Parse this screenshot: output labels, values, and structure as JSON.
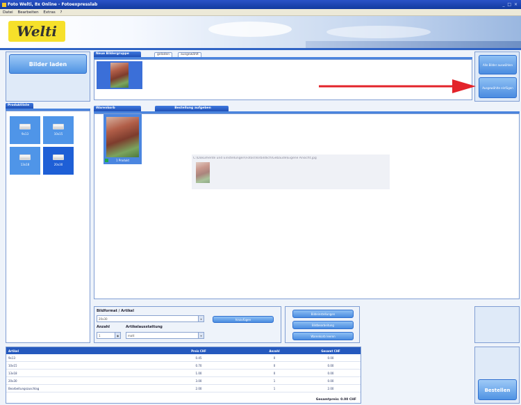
{
  "window": {
    "title": "Foto Welti, 8x Online - Fotoexpresslab",
    "controls": "_ □ ×"
  },
  "menu": [
    {
      "label": "Datei"
    },
    {
      "label": "Bearbeiten"
    },
    {
      "label": "Extras"
    },
    {
      "label": "?"
    }
  ],
  "brand": {
    "logo_text": "Welti",
    "accent": "#2f63c4",
    "logo_bg": "#f6e02a"
  },
  "left_panel": {
    "load_button": "Bilder laden",
    "products_tab": "Produktliste",
    "products": [
      {
        "label": "9x13"
      },
      {
        "label": "10x15"
      },
      {
        "label": "13x18"
      },
      {
        "label": "20x30"
      }
    ],
    "selected_product": "20x30"
  },
  "gallery": {
    "tab_label": "Neue Bildergruppe",
    "filter_tabs": [
      {
        "label": "geladen"
      },
      {
        "label": "ausgewählt"
      }
    ]
  },
  "right_buttons": {
    "select_all": "Alle Bilder auswählen",
    "add_selected": "Ausgewählte einfügen"
  },
  "cart": {
    "tab_label": "Warenkorb",
    "action_tab": "Bestellung aufgeben",
    "thumb_caption": "1 Produkt",
    "drag_path": "C:\\Dokumente und Einstellungen\\Fotos\\Vorbildlich\\Gebäude\\Eigene Ansicht.jpg"
  },
  "article_form": {
    "title": "Bildformat / Artikel",
    "format_value": "20x30",
    "add_button": "hinzufügen",
    "qty_label": "Anzahl",
    "qty_value": "1",
    "finish_label": "Artikelausstattung",
    "finish_value": "matt"
  },
  "extra_buttons": [
    {
      "label": "Bildeinstellungen"
    },
    {
      "label": "Bildbearbeitung"
    },
    {
      "label": "Warenkorb leeren"
    }
  ],
  "order_table": {
    "headers": [
      "Artikel",
      "Preis CHF",
      "Anzahl",
      "Gesamt CHF"
    ],
    "rows": [
      [
        "9x13",
        "0.45",
        "0",
        "0.00"
      ],
      [
        "10x15",
        "0.70",
        "0",
        "0.00"
      ],
      [
        "13x18",
        "1.00",
        "0",
        "0.00"
      ],
      [
        "20x30",
        "3.00",
        "1",
        "0.00"
      ],
      [
        "Bearbeitungszuschlag",
        "2.00",
        "1",
        "2.00"
      ]
    ],
    "total": "Gesamtpreis: 0.00 CHF"
  },
  "order_button": "Bestellen"
}
